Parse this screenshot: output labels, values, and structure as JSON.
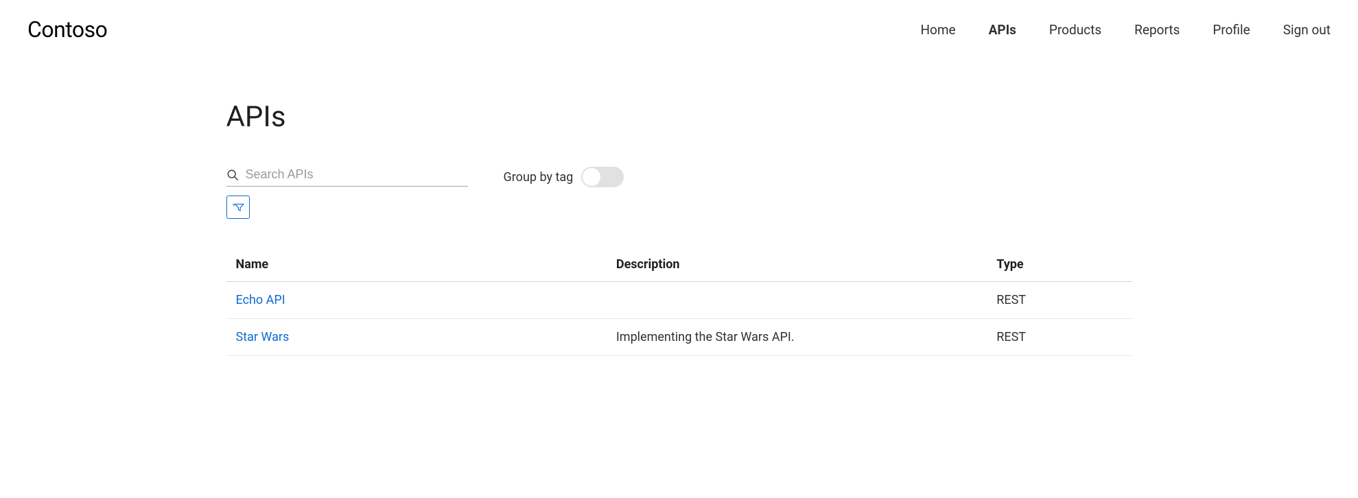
{
  "brand": "Contoso",
  "nav": {
    "items": [
      {
        "label": "Home",
        "active": false
      },
      {
        "label": "APIs",
        "active": true
      },
      {
        "label": "Products",
        "active": false
      },
      {
        "label": "Reports",
        "active": false
      },
      {
        "label": "Profile",
        "active": false
      },
      {
        "label": "Sign out",
        "active": false
      }
    ]
  },
  "page": {
    "title": "APIs"
  },
  "search": {
    "placeholder": "Search APIs",
    "value": ""
  },
  "group_by_tag": {
    "label": "Group by tag",
    "enabled": false
  },
  "table": {
    "headers": {
      "name": "Name",
      "description": "Description",
      "type": "Type"
    },
    "rows": [
      {
        "name": "Echo API",
        "description": "",
        "type": "REST"
      },
      {
        "name": "Star Wars",
        "description": "Implementing the Star Wars API.",
        "type": "REST"
      }
    ]
  }
}
